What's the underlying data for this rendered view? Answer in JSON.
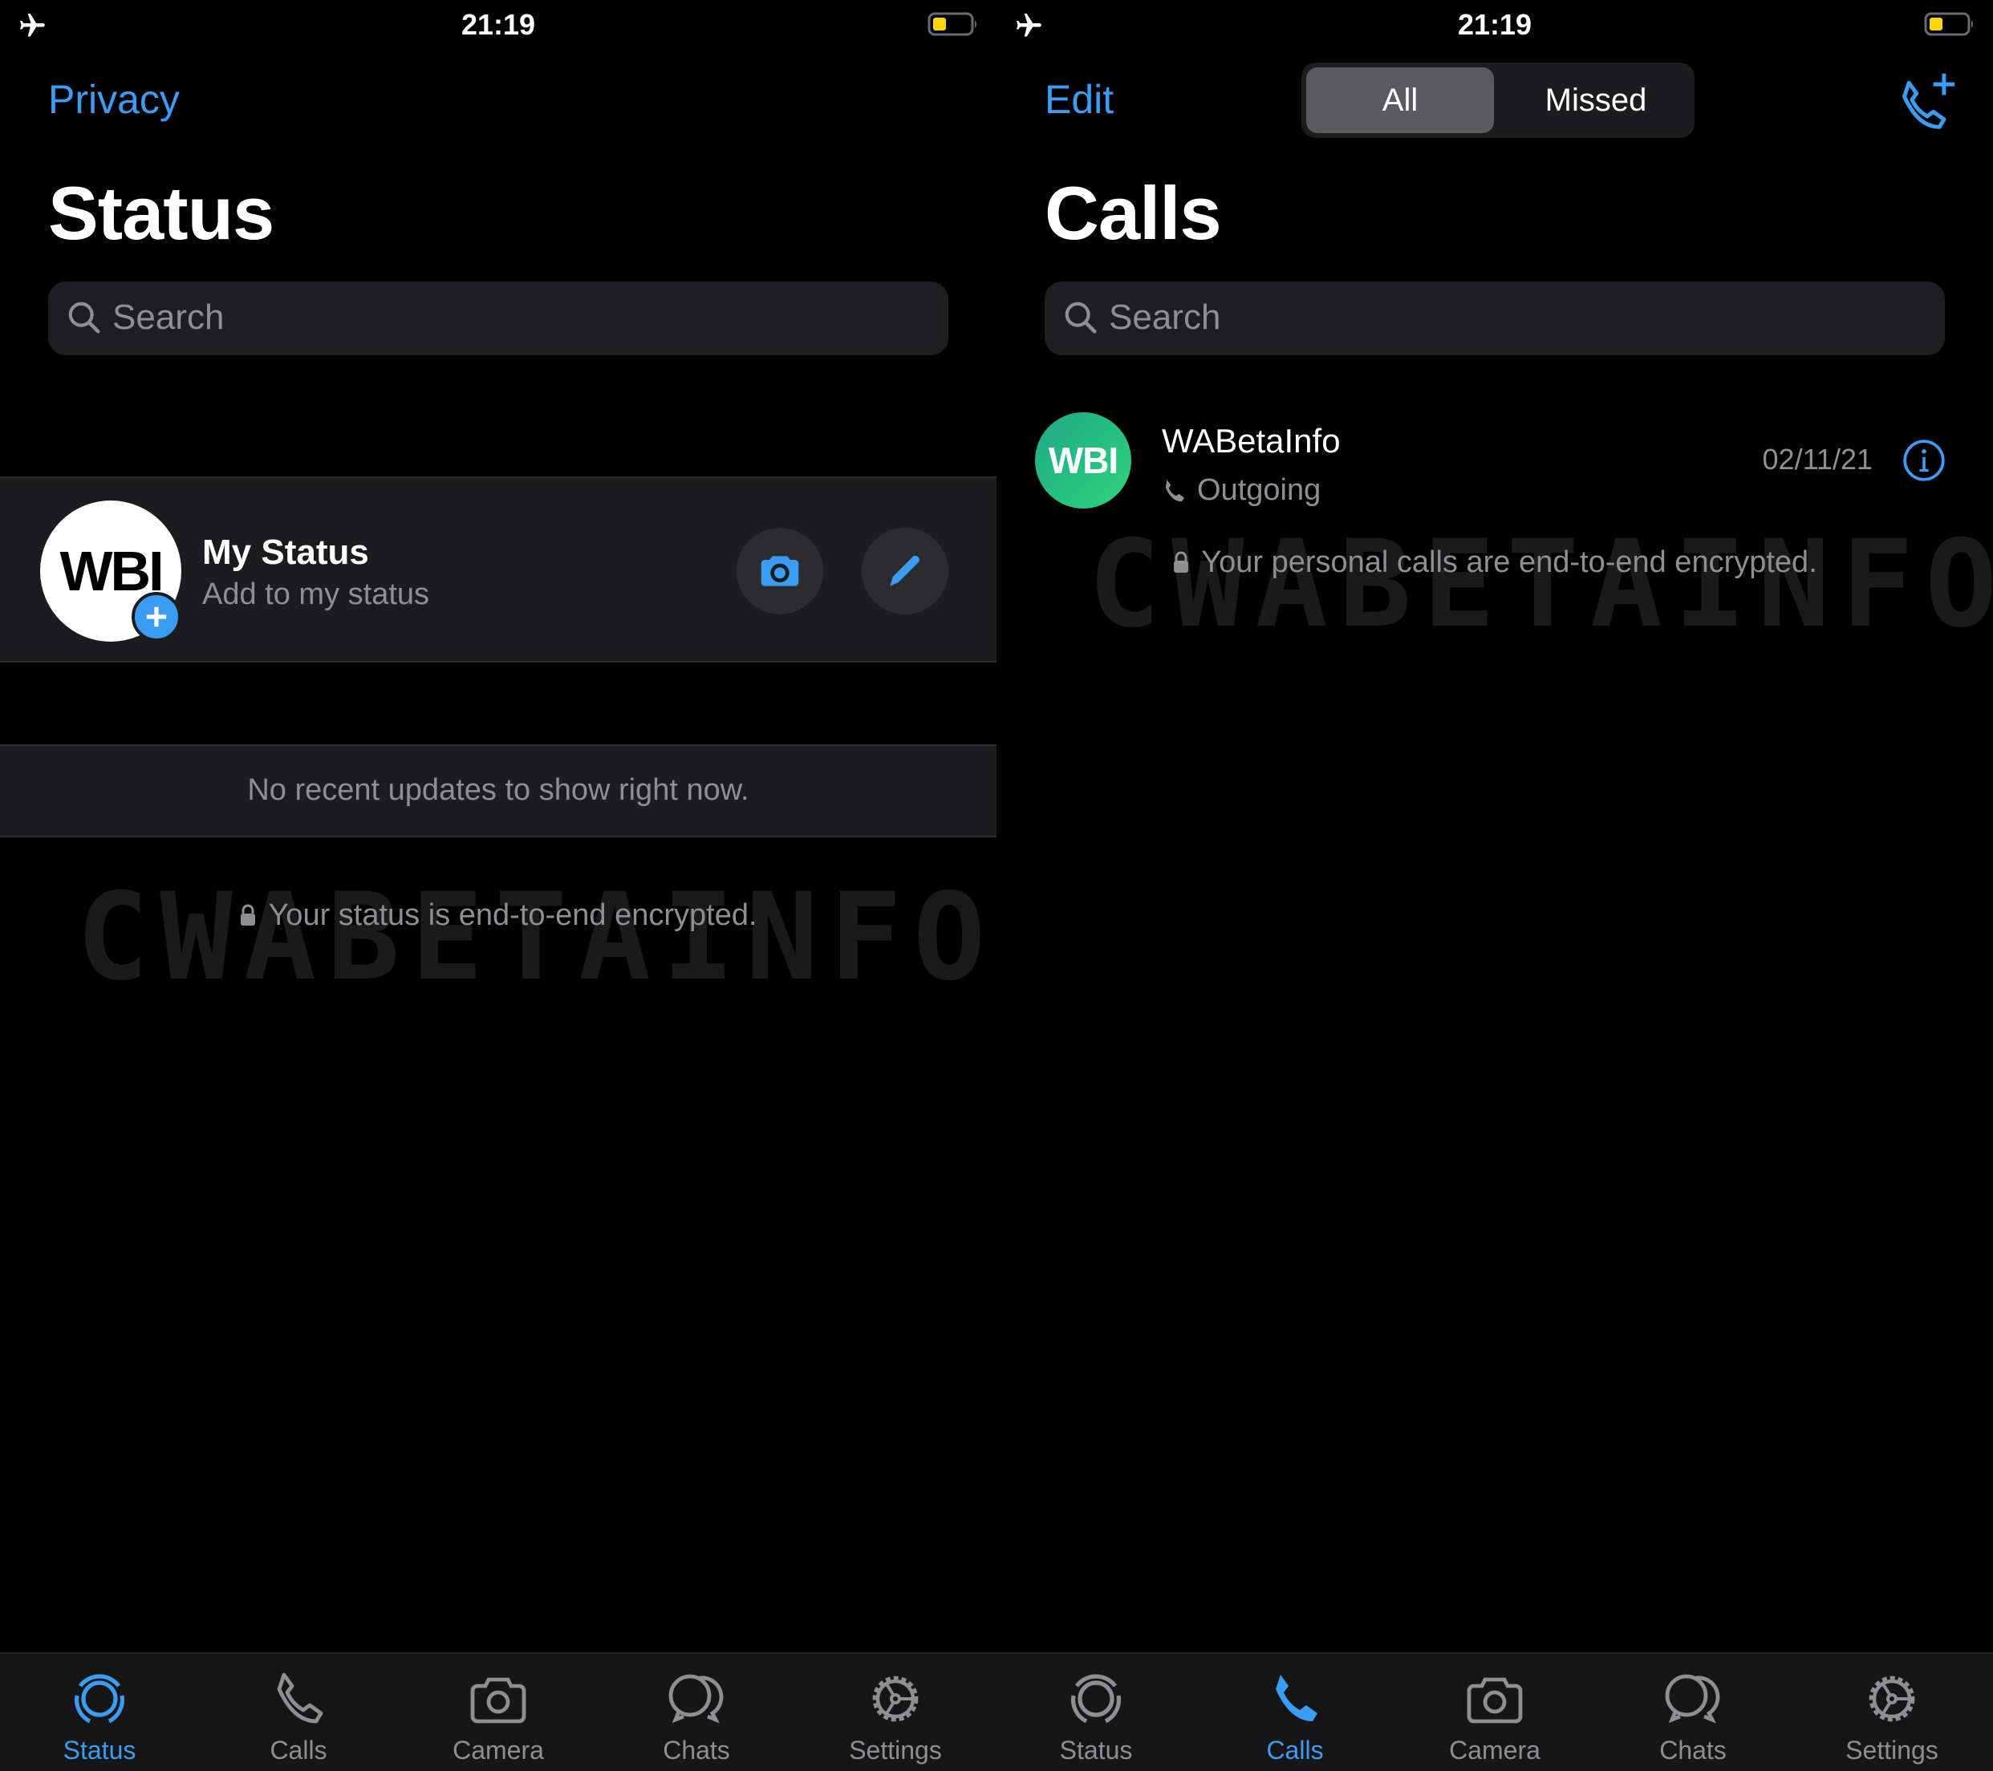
{
  "status_bar": {
    "time": "21:19",
    "airplane_icon": "airplane-icon",
    "battery_icon": "battery-icon",
    "battery_color": "#ffd60a"
  },
  "status_screen": {
    "nav_link": "Privacy",
    "title": "Status",
    "search_placeholder": "Search",
    "my_status": {
      "avatar_text": "WBI",
      "title": "My Status",
      "subtitle": "Add to my status"
    },
    "empty_message": "No recent updates to show right now.",
    "encryption_note": "Your status is end-to-end encrypted.",
    "watermark": "CWABETAINFO"
  },
  "calls_screen": {
    "nav_link": "Edit",
    "segments": [
      "All",
      "Missed"
    ],
    "selected_segment": "All",
    "title": "Calls",
    "search_placeholder": "Search",
    "calls": [
      {
        "name": "WABetaInfo",
        "avatar_text": "WBI",
        "type": "Outgoing",
        "date": "02/11/21"
      }
    ],
    "encryption_note": "Your personal calls are end-to-end encrypted.",
    "watermark": "CWABETAINFO"
  },
  "tabbar": {
    "items": [
      "Status",
      "Calls",
      "Camera",
      "Chats",
      "Settings"
    ],
    "left_active": "Status",
    "right_active": "Calls"
  },
  "colors": {
    "accent": "#3a9cf2",
    "secondary_text": "#8e8e93",
    "cell_bg": "#1c1c1e",
    "tabbar_bg": "#161616"
  }
}
